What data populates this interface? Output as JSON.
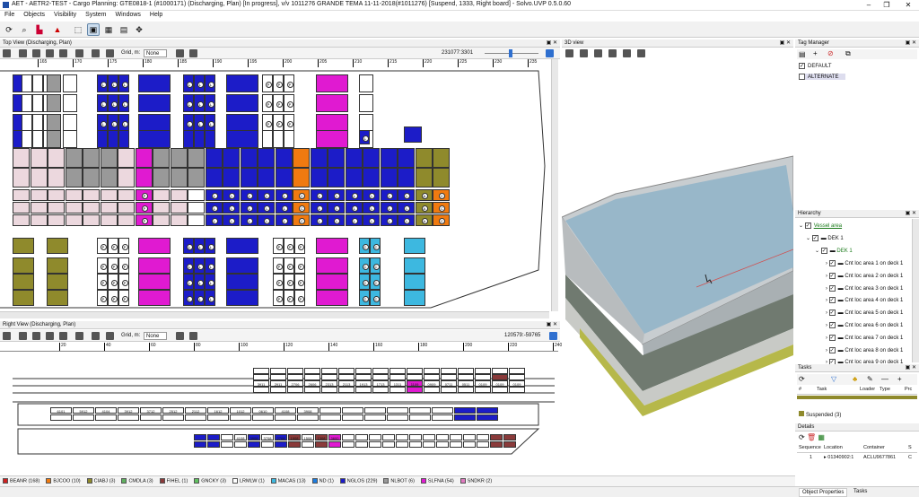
{
  "window": {
    "title": "AET - AETR2-TEST - Cargo Planning: GTE0818-1 (#1000171) (Discharging, Plan) [In progress], v/v 1011276 GRANDE TEMA 11-11-2018(#1011276) [Suspend, 1333, Right board] - Solvo.UVP 0.5.0.60"
  },
  "menu": [
    "File",
    "Objects",
    "Visibility",
    "System",
    "Windows",
    "Help"
  ],
  "top_view": {
    "title": "Top View (Discharging, Plan)",
    "grid_label": "Grid, m:",
    "grid_value": "None",
    "coords": "231077:3301",
    "ruler": [
      "165",
      "170",
      "175",
      "180",
      "185",
      "190",
      "195",
      "200",
      "205",
      "210",
      "215",
      "220",
      "225",
      "230",
      "235"
    ],
    "row_labels": [
      "908"
    ]
  },
  "right_view": {
    "title": "Right View (Discharging, Plan)",
    "grid_label": "Grid, m:",
    "grid_value": "None",
    "coords": "120579:-59765",
    "ruler": [
      "20",
      "40",
      "60",
      "80",
      "100",
      "120",
      "140",
      "160",
      "180",
      "200",
      "220",
      "240"
    ],
    "cell_codes": [
      "3613",
      "3313",
      "3911",
      "2911",
      "2706",
      "2606",
      "2313",
      "2113",
      "1913",
      "1713",
      "1311",
      "1109",
      "0909",
      "0711",
      "0511",
      "0109",
      "6101",
      "5912",
      "4104",
      "3912",
      "3712",
      "2512",
      "2112",
      "1612",
      "1012",
      "0610",
      "4108",
      "3908",
      "3708",
      "2708",
      "1908",
      "1508",
      "1308",
      "3600",
      "2900"
    ]
  },
  "view3d": {
    "title": "3D view"
  },
  "tag_manager": {
    "title": "Tag Manager",
    "tags": [
      {
        "label": "DEFAULT",
        "checked": true
      },
      {
        "label": "ALTERNATE",
        "checked": false
      }
    ]
  },
  "hierarchy": {
    "title": "Hierarchy",
    "root": "Vessel area",
    "deck": "DEK 1",
    "subdeck": "DEK 1",
    "items": [
      "Cnt loc area 1 on deck 1",
      "Cnt loc area 2 on deck 1",
      "Cnt loc area 3 on deck 1",
      "Cnt loc area 4 on deck 1",
      "Cnt loc area 5 on deck 1",
      "Cnt loc area 6 on deck 1",
      "Cnt loc area 7 on deck 1",
      "Cnt loc area 8 on deck 1",
      "Cnt loc area 9 on deck 1"
    ]
  },
  "tasks": {
    "title": "Tasks",
    "columns": [
      "#",
      "Task",
      "Loader",
      "Type",
      "Prc"
    ],
    "group": "Suspended (3)"
  },
  "details": {
    "title": "Details",
    "columns": [
      "Sequence",
      "Location",
      "Container",
      "S"
    ],
    "row": {
      "sequence": "1",
      "location": "01340902:1",
      "container": "ACLU9677861",
      "s": "C"
    }
  },
  "bottom_tabs": [
    "Object Properties",
    "Tasks"
  ],
  "legend": [
    {
      "label": "BEANR (168)",
      "color": "#d02020"
    },
    {
      "label": "BJCOO (10)",
      "color": "#f07a10"
    },
    {
      "label": "CIABJ (3)",
      "color": "#8f8a2c"
    },
    {
      "label": "CMDLA (3)",
      "color": "#60b060"
    },
    {
      "label": "FIHEL (1)",
      "color": "#8a3a3a"
    },
    {
      "label": "GNCKY (3)",
      "color": "#60c060"
    },
    {
      "label": "LRMLW (1)",
      "color": "#ffffff"
    },
    {
      "label": "MACAS (13)",
      "color": "#3db8e0"
    },
    {
      "label": "ND (1)",
      "color": "#1c7ce0"
    },
    {
      "label": "NGLOS (229)",
      "color": "#1c1cc8"
    },
    {
      "label": "NLBOT (6)",
      "color": "#999999"
    },
    {
      "label": "SLFNA (54)",
      "color": "#e01ad1"
    },
    {
      "label": "SNDKR (2)",
      "color": "#e07ac0"
    }
  ]
}
